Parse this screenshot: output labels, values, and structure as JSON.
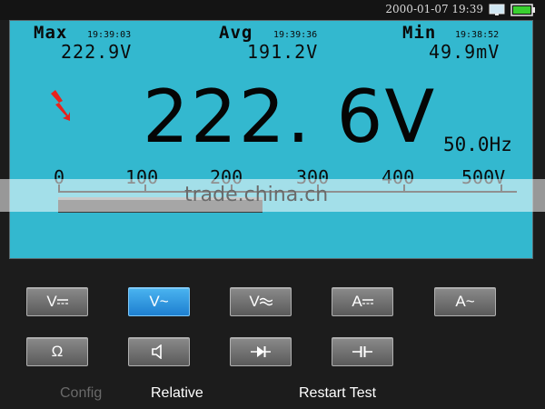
{
  "status_bar": {
    "datetime": "2000-01-07  19:39",
    "icons": [
      "monitor-icon",
      "battery-icon"
    ],
    "battery_color": "#39d030"
  },
  "display": {
    "background_color": "#33b8cf",
    "max": {
      "label": "Max",
      "time": "19:39:03",
      "value": "222.9V"
    },
    "avg": {
      "label": "Avg",
      "time": "19:39:36",
      "value": "191.2V"
    },
    "min": {
      "label": "Min",
      "time": "19:38:52",
      "value": "49.9mV"
    },
    "hazard_icon": "high-voltage-icon",
    "hazard_color": "#e8231c",
    "main_reading": "222. 6V",
    "frequency": "50.0Hz",
    "scale_labels": [
      "0",
      "100",
      "200",
      "300",
      "400",
      "500V"
    ],
    "bar_level_fraction": 0.445
  },
  "watermark": "trade.china.cn",
  "modes": [
    {
      "name": "dc-voltage",
      "label": "V",
      "symbol": "dc",
      "active": false
    },
    {
      "name": "ac-voltage",
      "label": "V~",
      "symbol": "ac",
      "active": true
    },
    {
      "name": "ac-dc-voltage",
      "label": "V",
      "symbol": "acdc",
      "active": false
    },
    {
      "name": "dc-current",
      "label": "A",
      "symbol": "dc",
      "active": false
    },
    {
      "name": "ac-current",
      "label": "A~",
      "symbol": "ac",
      "active": false
    },
    {
      "name": "resistance",
      "label": "Ω",
      "symbol": "ohm",
      "active": false
    },
    {
      "name": "continuity",
      "icon": "speaker-icon",
      "active": false
    },
    {
      "name": "diode",
      "icon": "diode-icon",
      "active": false
    },
    {
      "name": "capacitance",
      "icon": "capacitor-icon",
      "active": false
    }
  ],
  "soft_keys": {
    "config": {
      "label": "Config",
      "enabled": false
    },
    "relative": {
      "label": "Relative",
      "enabled": true
    },
    "restart": {
      "label": "Restart Test",
      "enabled": true
    }
  },
  "colors": {
    "active_button": "#1e7fd0",
    "button": "#6a6a6a"
  }
}
